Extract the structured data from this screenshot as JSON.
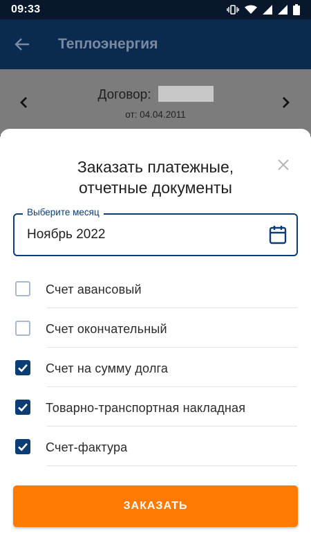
{
  "status_bar": {
    "time": "09:33",
    "icons": [
      "vibrate-icon",
      "wifi-icon",
      "signal-icon",
      "signal-icon",
      "battery-icon"
    ]
  },
  "app_bar": {
    "title": "Теплоэнергия",
    "back_icon": "arrow-left-icon"
  },
  "contract": {
    "label": "Договор:",
    "date_text": "от: 04.04.2011",
    "prev_icon": "chevron-left-icon",
    "next_icon": "chevron-right-icon"
  },
  "sheet": {
    "title_line1": "Заказать платежные,",
    "title_line2": "отчетные документы",
    "close_icon": "close-icon",
    "month_field": {
      "legend": "Выберите месяц",
      "value": "Ноябрь 2022",
      "icon": "calendar-icon"
    },
    "documents": [
      {
        "label": "Счет авансовый",
        "checked": false
      },
      {
        "label": "Счет окончательный",
        "checked": false
      },
      {
        "label": "Счет на сумму долга",
        "checked": true
      },
      {
        "label": "Товарно-транспортная накладная",
        "checked": true
      },
      {
        "label": "Счет-фактура",
        "checked": true
      }
    ],
    "order_button": "ЗАКАЗАТЬ"
  },
  "colors": {
    "primary": "#0c3c74",
    "accent": "#ff7a00",
    "app_bar": "#0a2a50",
    "overlay_strip": "#7c7c7c"
  }
}
